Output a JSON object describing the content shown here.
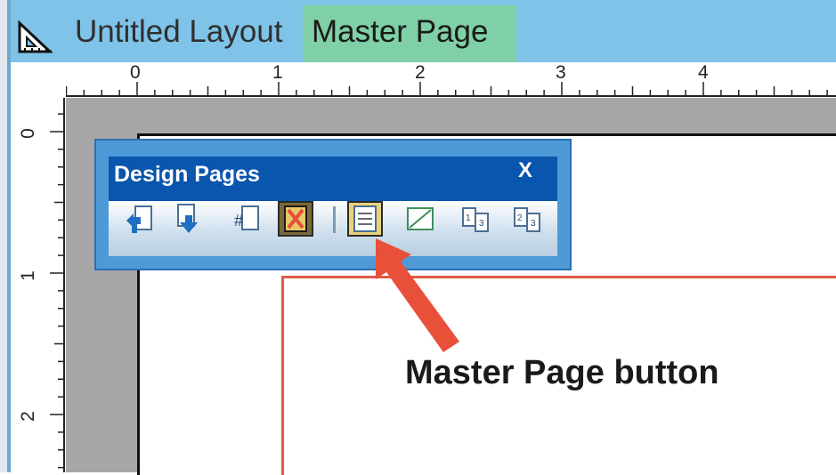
{
  "window": {
    "title": "Untitled Layout",
    "mode_label": "Master Page",
    "icon": "layout-ruler-icon"
  },
  "rulers": {
    "top_labels": [
      "0",
      "1",
      "2",
      "3",
      "4"
    ],
    "left_labels": [
      "0",
      "1",
      "2"
    ]
  },
  "toolbar": {
    "title": "Design Pages",
    "close": "X",
    "buttons": [
      {
        "name": "insert-page-before-icon"
      },
      {
        "name": "insert-page-after-icon"
      },
      {
        "name": "page-number-icon"
      },
      {
        "name": "delete-page-icon"
      },
      {
        "name": "master-page-icon"
      },
      {
        "name": "ignore-master-icon"
      },
      {
        "name": "move-page-forward-icon"
      },
      {
        "name": "move-page-back-icon"
      }
    ]
  },
  "annotation": {
    "text": "Master Page button",
    "arrow_color": "#e8503a"
  }
}
